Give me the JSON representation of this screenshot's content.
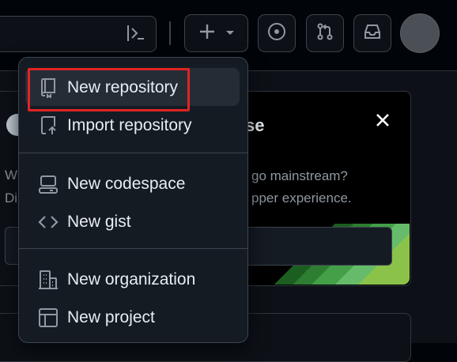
{
  "header": {
    "command_palette_icon": "terminal-icon",
    "create_icon": "plus-icon",
    "create_caret_icon": "triangle-down-icon",
    "issues_icon": "issue-opened-icon",
    "pulls_icon": "git-pull-request-icon",
    "inbox_icon": "inbox-icon"
  },
  "menu": {
    "items": [
      {
        "label": "New repository",
        "icon": "repo-icon"
      },
      {
        "label": "Import repository",
        "icon": "repo-push-icon"
      },
      {
        "label": "New codespace",
        "icon": "codespaces-icon"
      },
      {
        "label": "New gist",
        "icon": "code-icon"
      },
      {
        "label": "New organization",
        "icon": "organization-icon"
      },
      {
        "label": "New project",
        "icon": "table-icon"
      }
    ]
  },
  "background": {
    "left_line1": "W",
    "left_line2": "Di",
    "promo_title": "se",
    "promo_line1": "go mainstream?",
    "promo_line2": "pper experience."
  },
  "colors": {
    "highlight": "#e02424",
    "page_bg": "#0d1117",
    "menu_bg": "#151b23"
  }
}
